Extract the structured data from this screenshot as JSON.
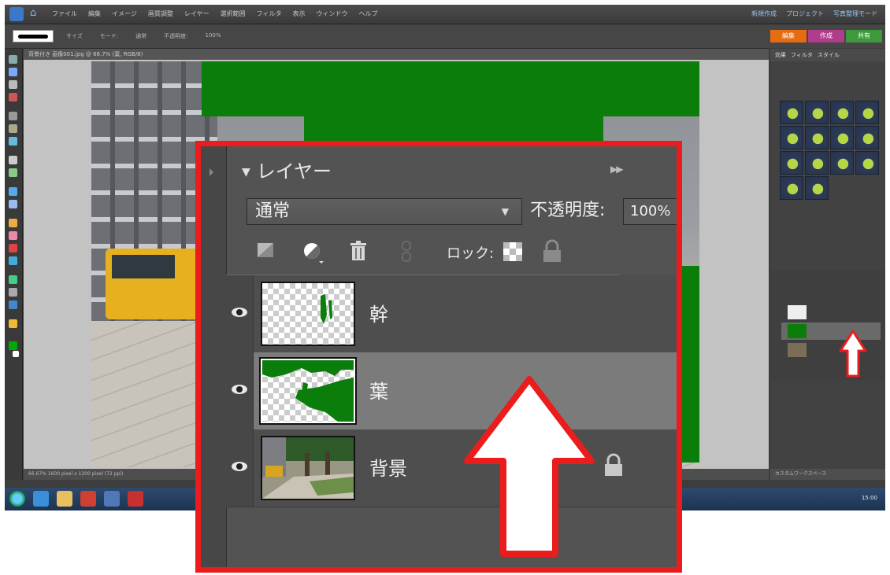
{
  "app": {
    "menus": [
      "ファイル",
      "編集",
      "イメージ",
      "画質調整",
      "レイヤー",
      "選択範囲",
      "フィルタ",
      "表示",
      "ウィンドウ",
      "ヘルプ"
    ],
    "right_menus": [
      "新規作成",
      "プロジェクト",
      "写真整理モード"
    ],
    "mode_tabs": [
      "編集",
      "作成",
      "共有"
    ],
    "options": [
      "サイズ",
      "モード:",
      "通常",
      "不透明度:",
      "100%"
    ],
    "doc_title": "背景付き 画像001.jpg @ 66.7% (葉, RGB/8)",
    "doc_status": "66.67%  1600 pixel x 1200 pixel (72 ppi)",
    "panel_tabs": [
      "効果",
      "フィルタ",
      "スタイル"
    ],
    "right_status": "カスタムワークスペース",
    "tray_time": "15:00"
  },
  "layers_panel": {
    "title": "レイヤー",
    "blend_mode": "通常",
    "opacity_label": "不透明度:",
    "opacity_value": "100%",
    "lock_label": "ロック:",
    "layers": [
      {
        "name": "幹",
        "selected": false,
        "locked": false
      },
      {
        "name": "葉",
        "selected": true,
        "locked": false
      },
      {
        "name": "背景",
        "selected": false,
        "locked": true
      }
    ]
  },
  "colors": {
    "highlight_border": "#ea1c1c",
    "leaf_green": "#0a7d0a",
    "selected_row": "#7b7b7b",
    "arrow_fill": "#ffffff",
    "arrow_stroke": "#ea1c1c"
  }
}
